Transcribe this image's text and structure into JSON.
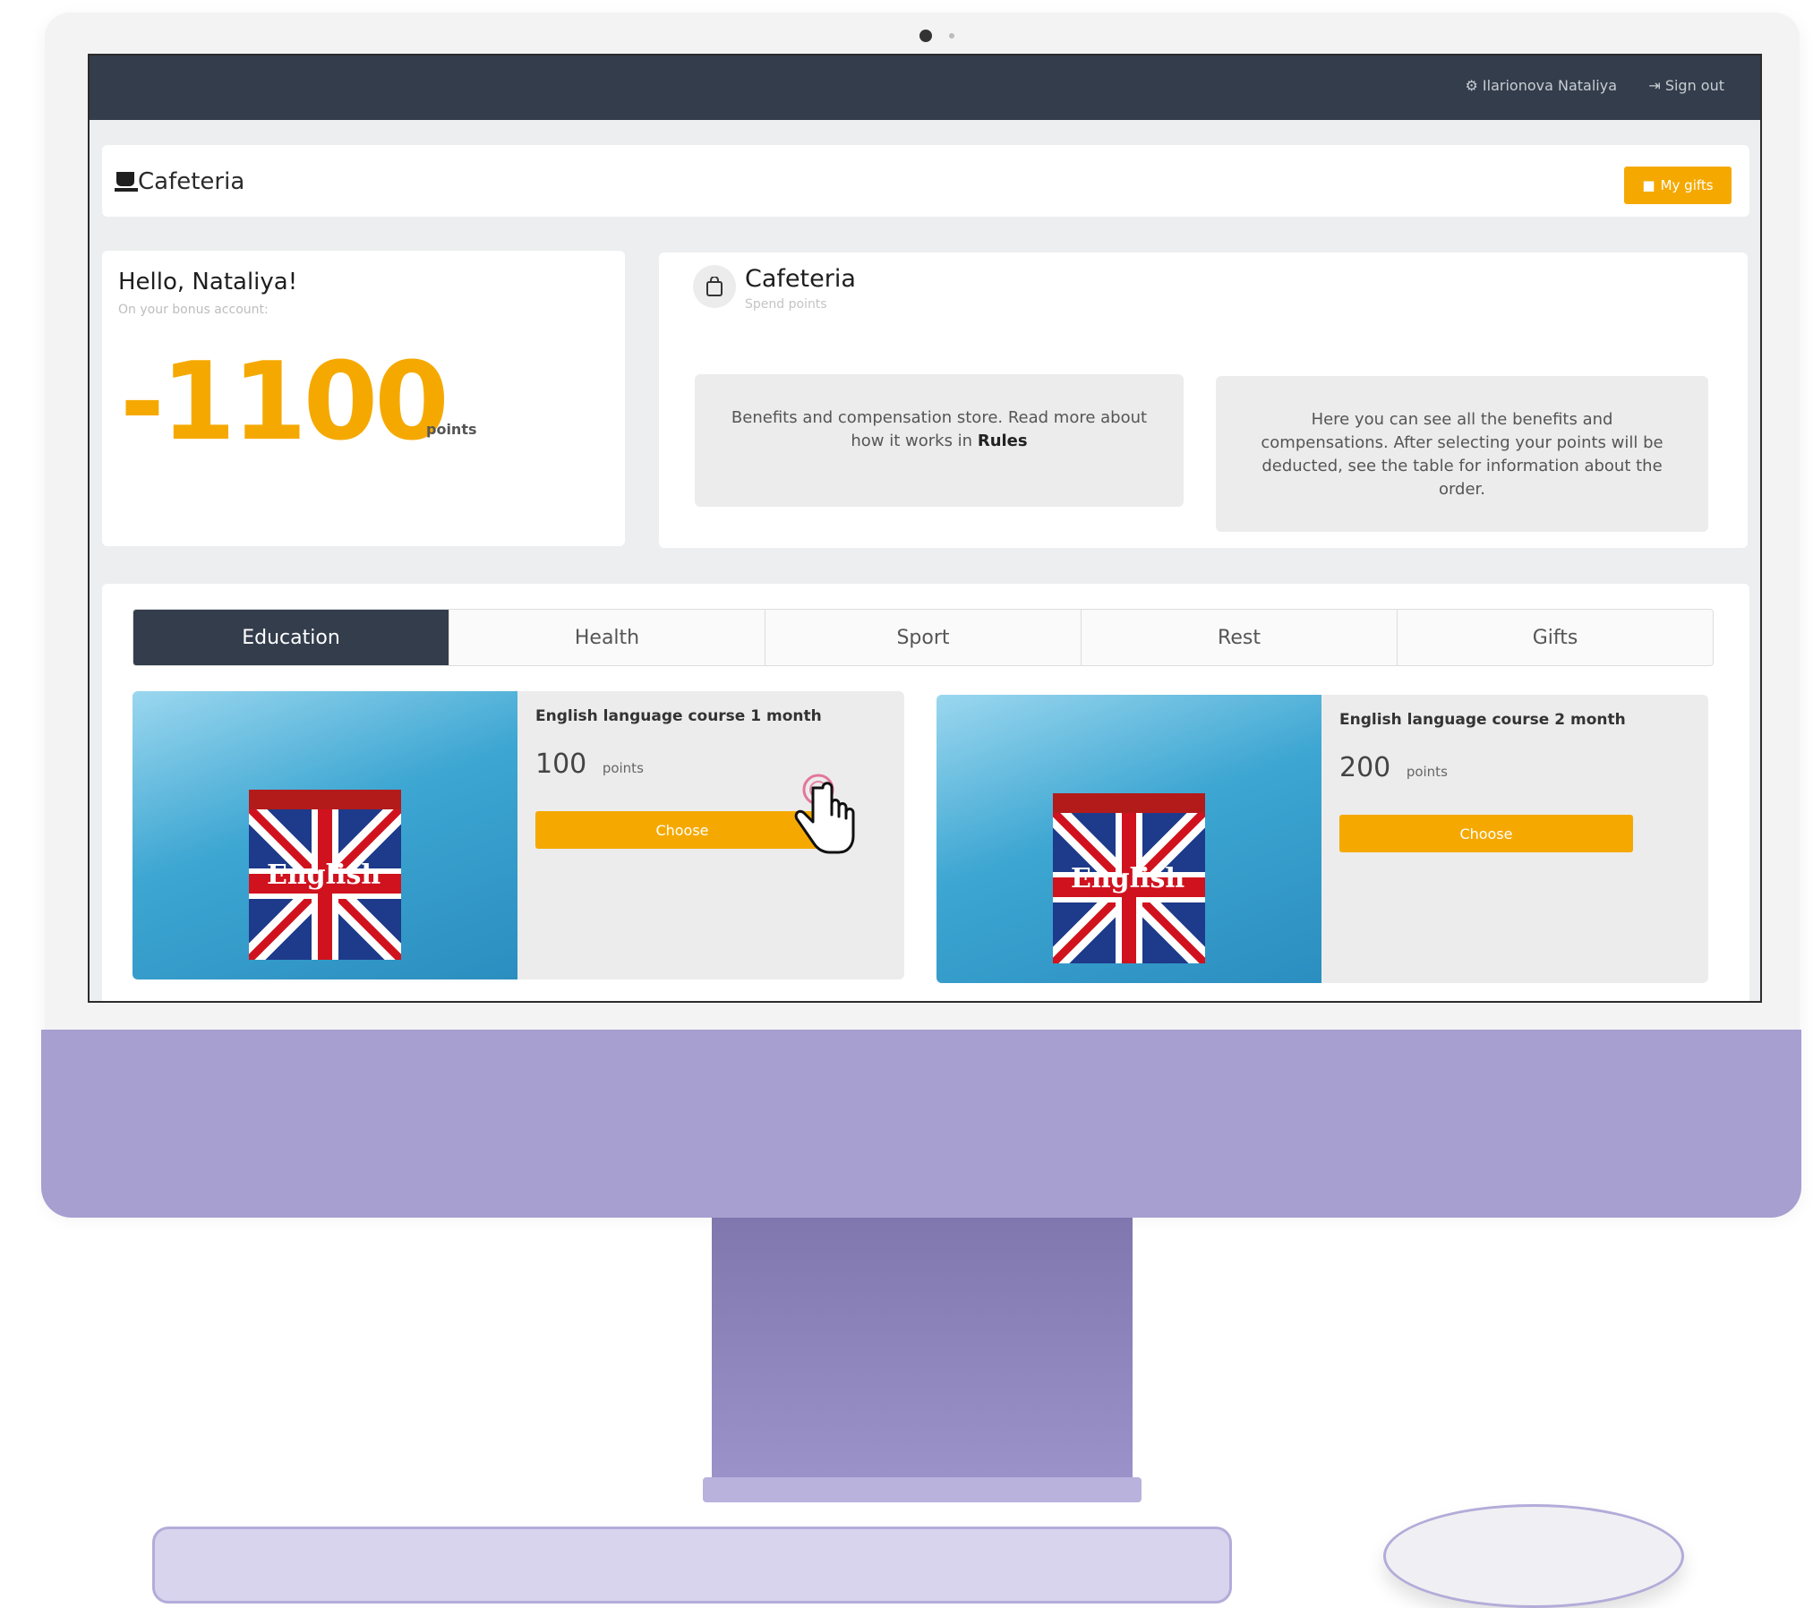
{
  "topbar": {
    "user_name": "Ilarionova Nataliya",
    "sign_out_label": "Sign out"
  },
  "header": {
    "title": "Cafeteria",
    "my_gifts_label": "My gifts"
  },
  "greeting": {
    "title": "Hello, Nataliya!",
    "subtitle": "On your bonus account:",
    "points_value": "-1100",
    "points_label": "points"
  },
  "cafeteria_info": {
    "title": "Cafeteria",
    "subtitle": "Spend points",
    "info1_text": "Benefits and compensation store. Read more about how it works in",
    "info1_link": "Rules",
    "info2_text": "Here you can see all the benefits and compensations. After selecting your points will be deducted, see the table for information about the order."
  },
  "tabs": [
    {
      "label": "Education",
      "active": true
    },
    {
      "label": "Health",
      "active": false
    },
    {
      "label": "Sport",
      "active": false
    },
    {
      "label": "Rest",
      "active": false
    },
    {
      "label": "Gifts",
      "active": false
    }
  ],
  "products": [
    {
      "name": "English language course 1 month",
      "price": "100",
      "price_unit": "points",
      "button_label": "Choose",
      "image_label": "English"
    },
    {
      "name": "English language course 2 month",
      "price": "200",
      "price_unit": "points",
      "button_label": "Choose",
      "image_label": "English"
    }
  ],
  "colors": {
    "accent": "#f5a900",
    "topbar": "#333d4c",
    "device": "#a69fd0"
  },
  "icons": [
    "cup-icon",
    "shopping-bag-icon",
    "gear-icon",
    "sign-out-icon",
    "gift-icon",
    "hand-pointer-icon"
  ]
}
